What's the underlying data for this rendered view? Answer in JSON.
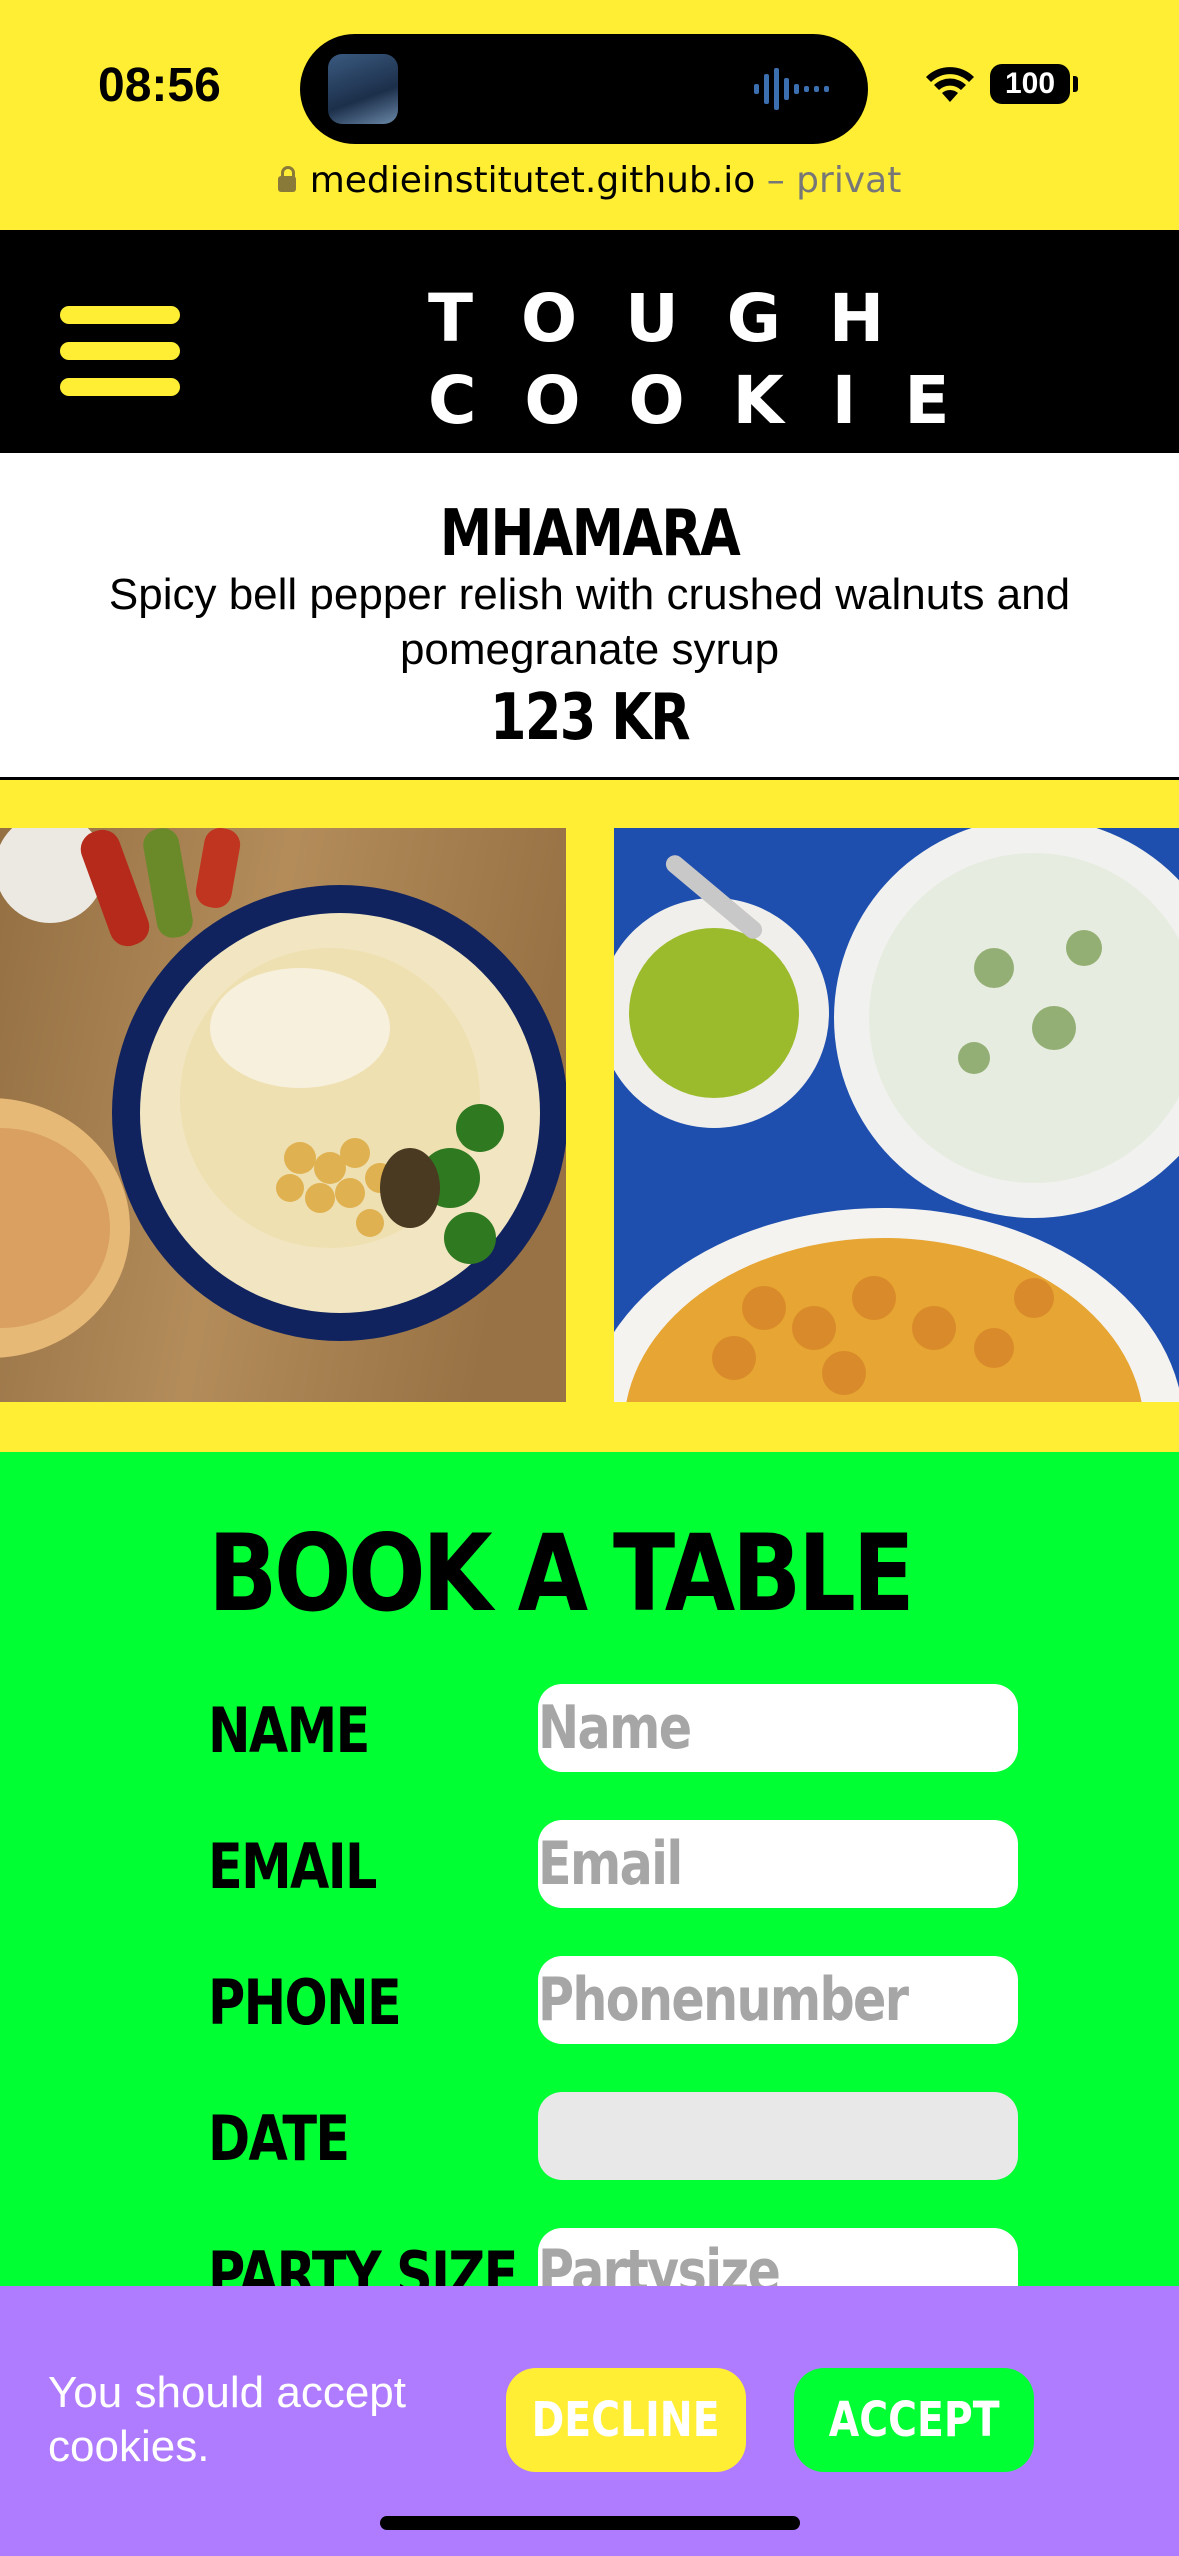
{
  "status_bar": {
    "time": "08:56",
    "battery": "100"
  },
  "browser": {
    "domain": "medieinstitutet.github.io",
    "mode": "– privat"
  },
  "header": {
    "logo_line1": "TOUGH",
    "logo_line2": "COOKIE"
  },
  "dish": {
    "title": "MHAMARA",
    "description": "Spicy bell pepper relish with crushed walnuts and pomegranate syrup",
    "price": "123 KR"
  },
  "booking": {
    "title": "BOOK A TABLE",
    "fields": [
      {
        "label": "NAME",
        "placeholder": "Name"
      },
      {
        "label": "EMAIL",
        "placeholder": "Email"
      },
      {
        "label": "PHONE",
        "placeholder": "Phonenumber"
      },
      {
        "label": "DATE",
        "placeholder": ""
      },
      {
        "label": "PARTY SIZE",
        "placeholder": "Partysize"
      }
    ]
  },
  "cookie_banner": {
    "text": "You should accept cookies.",
    "decline_label": "DECLINE",
    "accept_label": "ACCEPT"
  },
  "colors": {
    "yellow": "#ffee33",
    "green": "#00ff33",
    "purple": "#b07cff",
    "black": "#000000"
  }
}
